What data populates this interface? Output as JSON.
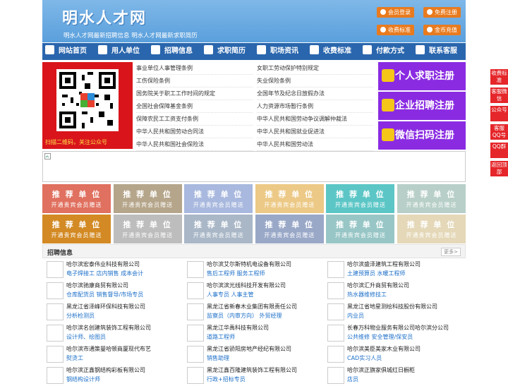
{
  "header": {
    "title": "明水人才网",
    "subtitle": "明水人才网最新招聘信息   明水人才网最新求职简历",
    "buttons": [
      "会员登录",
      "免费注册",
      "收费标准",
      "金币充值"
    ]
  },
  "nav": [
    {
      "label": "网站首页",
      "icon": "home-icon"
    },
    {
      "label": "用人单位",
      "icon": "building-icon"
    },
    {
      "label": "招聘信息",
      "icon": "megaphone-icon"
    },
    {
      "label": "求职简历",
      "icon": "resume-icon"
    },
    {
      "label": "职场资讯",
      "icon": "news-icon"
    },
    {
      "label": "收费标准",
      "icon": "yuan-icon"
    },
    {
      "label": "付款方式",
      "icon": "card-icon"
    },
    {
      "label": "联系客服",
      "icon": "phone-icon"
    }
  ],
  "qr": {
    "caption": "扫描二维码，关注公众号"
  },
  "regulations": [
    [
      "事业单位人事管理条例",
      "女职工劳动保护特别规定"
    ],
    [
      "工伤保险条例",
      "失业保险条例"
    ],
    [
      "国务院关于职工工作时间的规定",
      "全国年节及纪念日放假办法"
    ],
    [
      "全国社会保障基金条例",
      "人力资源市场暂行条例"
    ],
    [
      "保障农民工工资支付条例",
      "中华人民共和国劳动争议调解仲裁法"
    ],
    [
      "中华人民共和国劳动合同法",
      "中华人民共和国就业促进法"
    ],
    [
      "中华人民共和国社会保险法",
      "中华人民共和国劳动法"
    ]
  ],
  "register": [
    "个人求职注册",
    "企业招聘注册",
    "微信扫码注册"
  ],
  "recommend": {
    "title": "推 荐 单 位",
    "sub": "开通贵宾会员赠送",
    "colors": [
      "#e0705f",
      "#b5a58a",
      "#a8b8de",
      "#ecc986",
      "#5cc6c6",
      "#b7cfc8",
      "#d38a24",
      "#bdbdbd",
      "#a9b7c7",
      "#9aa8c8",
      "#98c6c6",
      "#e4d8b8"
    ]
  },
  "jobs": {
    "title": "招聘信息",
    "more": "更多>",
    "items": [
      {
        "company": "哈尔滨宏泰伟业科技有限公司",
        "positions": "电子焊接工 店内销售 成本会计"
      },
      {
        "company": "哈尔滨艾尔斯特机电设备有限公司",
        "positions": "售后工程师 服务工程师"
      },
      {
        "company": "哈尔滨盛泽建筑工程有限公司",
        "positions": "土建预算员 水暖工程师"
      },
      {
        "company": "哈尔滨驰康商贸有限公司",
        "positions": "仓库配货员 销售督导/市场专员"
      },
      {
        "company": "哈尔滨滨光线科技开发有限公司",
        "positions": "人事专员 人事主管"
      },
      {
        "company": "哈尔滨汇升商贸有限公司",
        "positions": "热水器维修技工"
      },
      {
        "company": "黑龙江省泽峰环保科技有限公司",
        "positions": "分析检测员"
      },
      {
        "company": "黑龙江省新春木业集团有限责任公司",
        "positions": "监察员（内审方向） 外贸经理"
      },
      {
        "company": "黑龙江省地星测绘科技股份有限公司",
        "positions": "内业员"
      },
      {
        "company": "哈尔滨名创建筑装饰工程有限公司",
        "positions": "设计师、绘图员"
      },
      {
        "company": "黑龙江华禹科技有限公司",
        "positions": "道路工程师"
      },
      {
        "company": "长春万科物业服务有限公司哈尔滨分公司",
        "positions": "公共维修 安全管理/保安员"
      },
      {
        "company": "哈尔滨市通策曼哈顿商厦现代布艺",
        "positions": "熨烫工"
      },
      {
        "company": "黑龙江省骄阳房地产经纪有限公司",
        "positions": "销售助理"
      },
      {
        "company": "哈尔滨美臣美家木业有限公司",
        "positions": "CAD实习人员"
      },
      {
        "company": "哈尔滨正鑫钢结构彩板有限公司",
        "positions": "钢结构设计师"
      },
      {
        "company": "黑龙江鑫百隆建筑装饰工程有限公司",
        "positions": "行政+招标专员"
      },
      {
        "company": "哈尔滨正旗家俱城红日橱柜",
        "positions": "店员"
      }
    ]
  },
  "side": [
    "收费标准",
    "客服微信",
    "公众号",
    "客服QQ号",
    "QQ群",
    "返回顶部"
  ]
}
